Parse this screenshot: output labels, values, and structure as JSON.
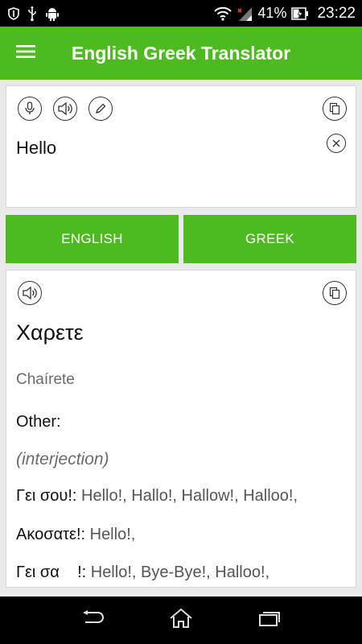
{
  "status_bar": {
    "battery": "41%",
    "time": "23:22"
  },
  "app_bar": {
    "title": "English Greek Translator"
  },
  "input": {
    "text": "Hello"
  },
  "languages": {
    "source": "ENGLISH",
    "target": "GREEK"
  },
  "output": {
    "translation": "Χαρετε",
    "transliteration": "Chaírete",
    "other_label": "Other:",
    "part_of_speech": "(interjection)",
    "entries": [
      {
        "term": "Γει σου!:",
        "synonyms": " Hello!, Hallo!, Hallow!, Halloo!,"
      },
      {
        "term": "Ακοσατε!:",
        "synonyms": " Hello!,"
      },
      {
        "term": "Γει σα    !:",
        "synonyms": " Hello!, Bye-Bye!, Halloo!,"
      }
    ]
  },
  "colors": {
    "accent": "#4dbb1f",
    "status_bar": "#000000",
    "background": "#eaeaea"
  },
  "icons": {
    "mic": "microphone-icon",
    "speaker": "speaker-icon",
    "pen": "pen-icon",
    "copy": "copy-icon",
    "clear": "clear-icon",
    "menu": "hamburger-menu-icon"
  }
}
